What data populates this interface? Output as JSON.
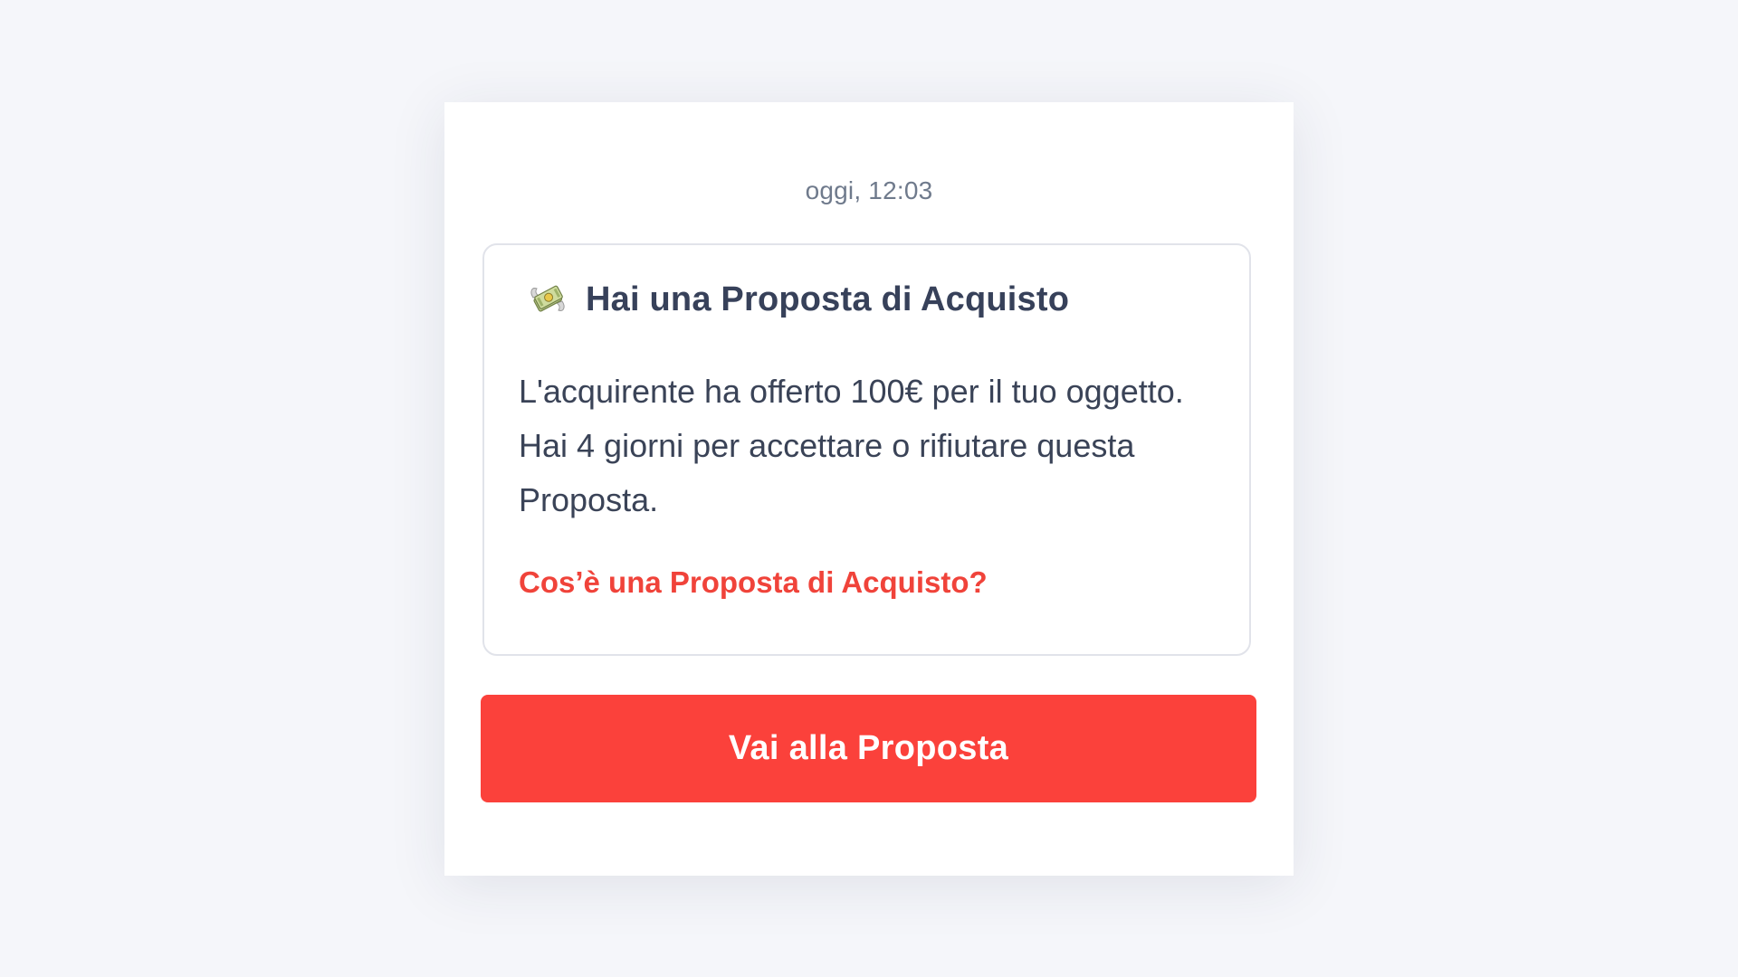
{
  "message": {
    "timestamp": "oggi, 12:03",
    "card": {
      "icon": "money-with-wings-icon",
      "title": "Hai una Proposta di Acquisto",
      "body": "L'acquirente ha offerto 100€ per il tuo oggetto. Hai 4 giorni per accettare o rifiutare questa Proposta.",
      "link_label": "Cos’è una Proposta di Acquisto?"
    },
    "cta_label": "Vai alla Proposta"
  },
  "colors": {
    "accent": "#fb413b",
    "link": "#f0433a",
    "text": "#37415a",
    "muted": "#6f7a8c",
    "background": "#f5f6fa"
  }
}
